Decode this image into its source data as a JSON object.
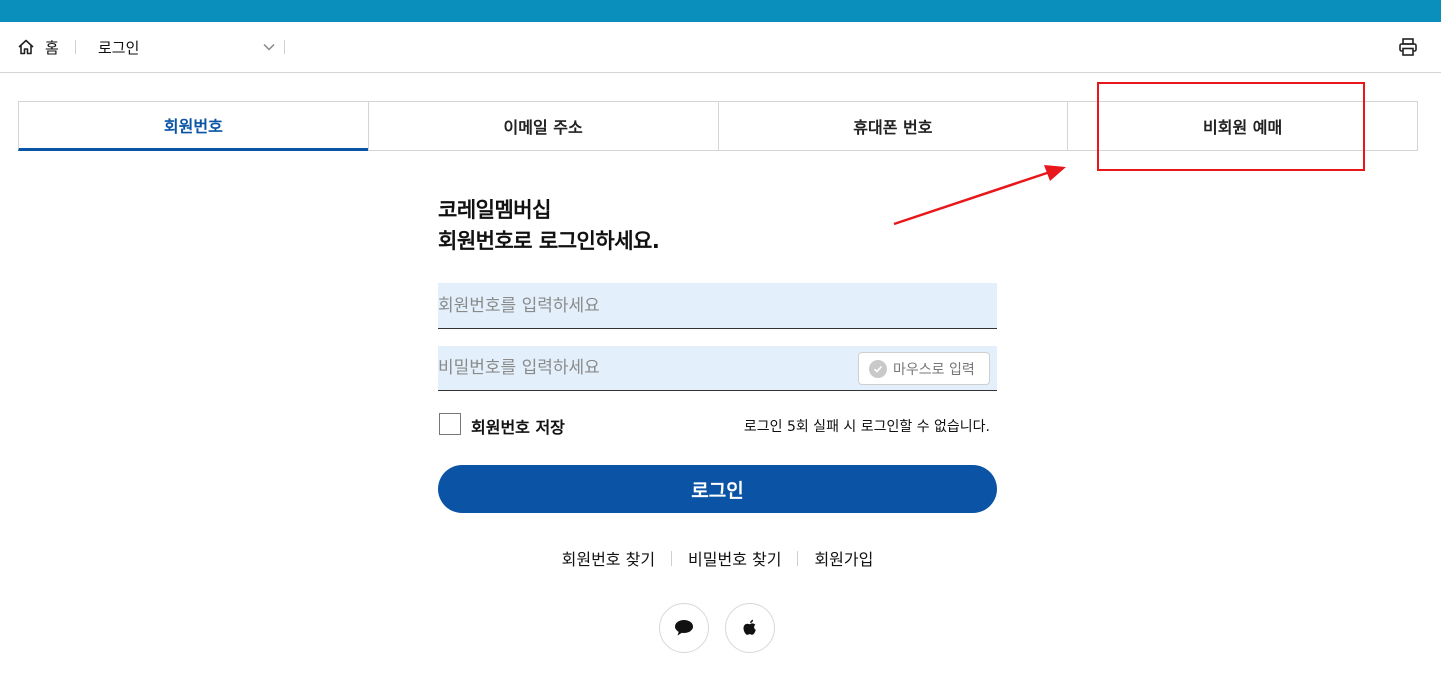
{
  "breadcrumb": {
    "home_label": "홈",
    "current_label": "로그인"
  },
  "tabs": [
    {
      "label": "회원번호",
      "active": true
    },
    {
      "label": "이메일 주소",
      "active": false
    },
    {
      "label": "휴대폰 번호",
      "active": false
    },
    {
      "label": "비회원 예매",
      "active": false
    }
  ],
  "heading": {
    "line1": "코레일멤버십",
    "line2": "회원번호로 로그인하세요."
  },
  "form": {
    "id_placeholder": "회원번호를 입력하세요",
    "id_value": "",
    "password_placeholder": "비밀번호를 입력하세요",
    "password_value": "",
    "mouse_input_label": "마우스로 입력",
    "save_id_label": "회원번호 저장",
    "save_id_checked": false,
    "fail_notice": "로그인 5회 실패 시 로그인할 수 없습니다.",
    "login_button_label": "로그인"
  },
  "links": {
    "find_id": "회원번호 찾기",
    "find_password": "비밀번호 찾기",
    "signup": "회원가입"
  },
  "social": {
    "kakao_icon": "speech-bubble-icon",
    "apple_icon": "apple-icon"
  },
  "colors": {
    "topbar": "#0a8fbc",
    "primary": "#0b54a5",
    "input_background": "#e3f0fc",
    "annotation": "#e8171b"
  }
}
